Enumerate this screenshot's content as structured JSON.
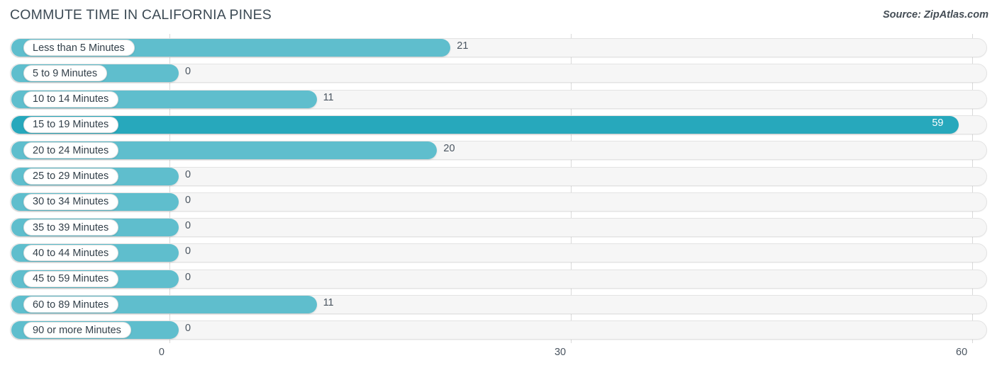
{
  "header": {
    "title": "COMMUTE TIME IN CALIFORNIA PINES",
    "source": "Source: ZipAtlas.com"
  },
  "colors": {
    "bar": "#5fbecd",
    "bar_highlight": "#27a8bc",
    "track": "#f6f6f6",
    "track_border": "#e3e3e3",
    "gridline": "#d9d9d9",
    "text": "#3a4a57",
    "value_inside": "#ffffff"
  },
  "chart_data": {
    "type": "bar",
    "orientation": "horizontal",
    "title": "COMMUTE TIME IN CALIFORNIA PINES",
    "xlabel": "",
    "ylabel": "",
    "xlim": [
      0,
      60
    ],
    "grid": true,
    "legend": false,
    "xticks": [
      0,
      30,
      60
    ],
    "xtick_labels": [
      "0",
      "30",
      "60"
    ],
    "categories": [
      "Less than 5 Minutes",
      "5 to 9 Minutes",
      "10 to 14 Minutes",
      "15 to 19 Minutes",
      "20 to 24 Minutes",
      "25 to 29 Minutes",
      "30 to 34 Minutes",
      "35 to 39 Minutes",
      "40 to 44 Minutes",
      "45 to 59 Minutes",
      "60 to 89 Minutes",
      "90 or more Minutes"
    ],
    "values": [
      21,
      0,
      11,
      59,
      20,
      0,
      0,
      0,
      0,
      0,
      11,
      0
    ],
    "value_labels": [
      "21",
      "0",
      "11",
      "59",
      "20",
      "0",
      "0",
      "0",
      "0",
      "0",
      "11",
      "0"
    ],
    "highlight_index": 3
  }
}
